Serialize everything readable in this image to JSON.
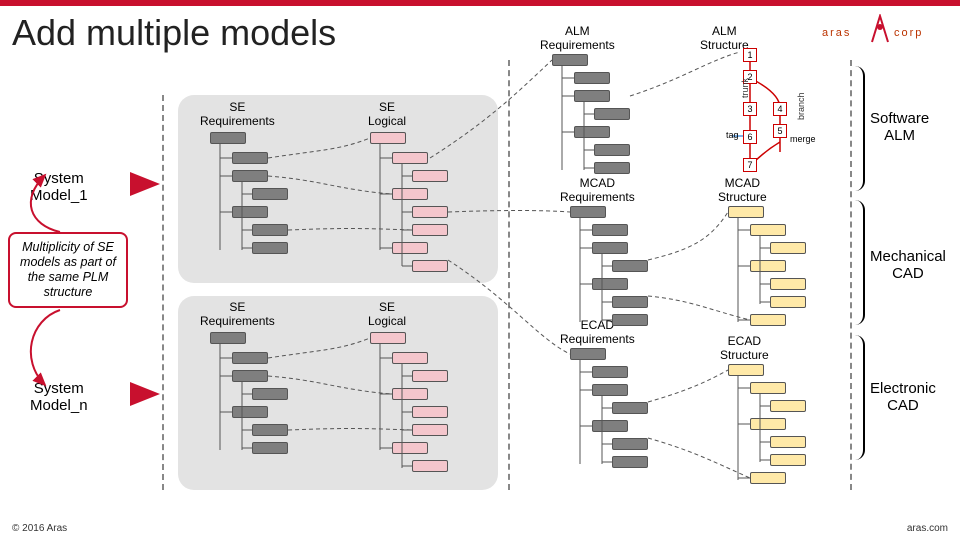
{
  "title": "Add multiple models",
  "footer": {
    "left": "© 2016 Aras",
    "right": "aras.com"
  },
  "logo": {
    "left": "aras",
    "right": "corp"
  },
  "sections": {
    "software": "Software\nALM",
    "mech": "Mechanical\nCAD",
    "ecad": "Electronic\nCAD"
  },
  "left_labels": {
    "sys1": "System\nModel_1",
    "sysn": "System\nModel_n",
    "bubble": "Multiplicity of SE models as part of the same PLM structure"
  },
  "tree_labels": {
    "se_req": "SE\nRequirements",
    "se_log": "SE\nLogical",
    "alm_req": "ALM\nRequirements",
    "alm_str": "ALM\nStructure",
    "mcad_req": "MCAD\nRequirements",
    "mcad_str": "MCAD\nStructure",
    "ecad_req": "ECAD\nRequirements",
    "ecad_str": "ECAD\nStructure"
  },
  "branch": {
    "trunk": "trunk",
    "branch": "branch",
    "tag": "tag",
    "merge": "merge",
    "nodes": [
      "1",
      "2",
      "3",
      "4",
      "5",
      "6",
      "7"
    ]
  }
}
